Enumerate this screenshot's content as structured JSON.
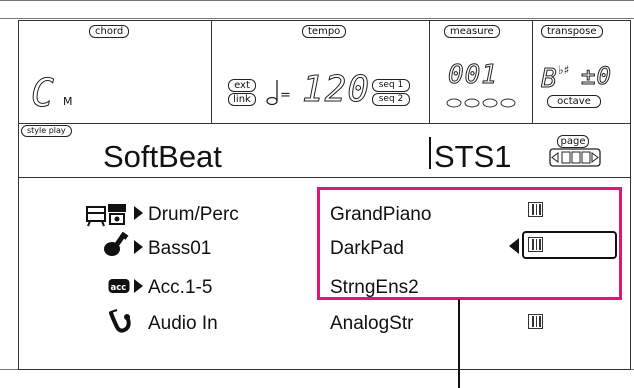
{
  "header": {
    "chord_label": "chord",
    "chord_value": "C",
    "chord_suffix": "M",
    "tempo_label": "tempo",
    "ext_label": "ext",
    "link_label": "link",
    "tempo_value": "120",
    "seq1_label": "seq 1",
    "seq2_label": "seq 2",
    "measure_label": "measure",
    "measure_value": "001",
    "transpose_label": "transpose",
    "transpose_value": "±0",
    "octave_label": "octave"
  },
  "style": {
    "mode_label": "style play",
    "name": "SoftBeat",
    "sts_name": "STS1",
    "page_label": "page"
  },
  "tracks": [
    {
      "label": "Drum/Perc",
      "sound": "GrandPiano",
      "icon": "drum-perc-icon"
    },
    {
      "label": "Bass01",
      "sound": "DarkPad",
      "icon": "guitar-icon"
    },
    {
      "label": "Acc.1-5",
      "sound": "StrngEns2",
      "icon": "acc-icon"
    },
    {
      "label": "Audio In",
      "sound": "AnalogStr",
      "icon": "saxophone-icon"
    }
  ],
  "colors": {
    "highlight": "#e0157a"
  }
}
